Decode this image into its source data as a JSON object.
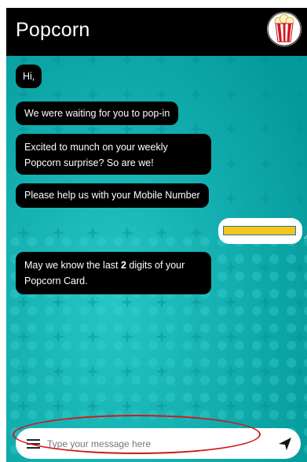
{
  "header": {
    "title": "Popcorn",
    "logo_icon": "popcorn-bucket-icon"
  },
  "messages": [
    {
      "sender": "bot",
      "text": "Hi,"
    },
    {
      "sender": "bot",
      "text": "We were waiting for you to pop-in"
    },
    {
      "sender": "bot",
      "text": "Excited to munch on your weekly Popcorn surprise? So are we!"
    },
    {
      "sender": "bot",
      "text": "Please help us with your Mobile Number"
    },
    {
      "sender": "user",
      "text": ""
    },
    {
      "sender": "bot",
      "text_before": "May we know the last ",
      "text_bold": "2",
      "text_after": " digits of your Popcorn Card."
    }
  ],
  "composer": {
    "placeholder": "Type your message here",
    "menu_icon": "hamburger-menu-icon",
    "send_icon": "send-icon"
  },
  "colors": {
    "background": "#0bb3b3",
    "header": "#000000",
    "bubble": "#000000",
    "masked_value": "#f5c518",
    "annotation": "#d01818"
  }
}
